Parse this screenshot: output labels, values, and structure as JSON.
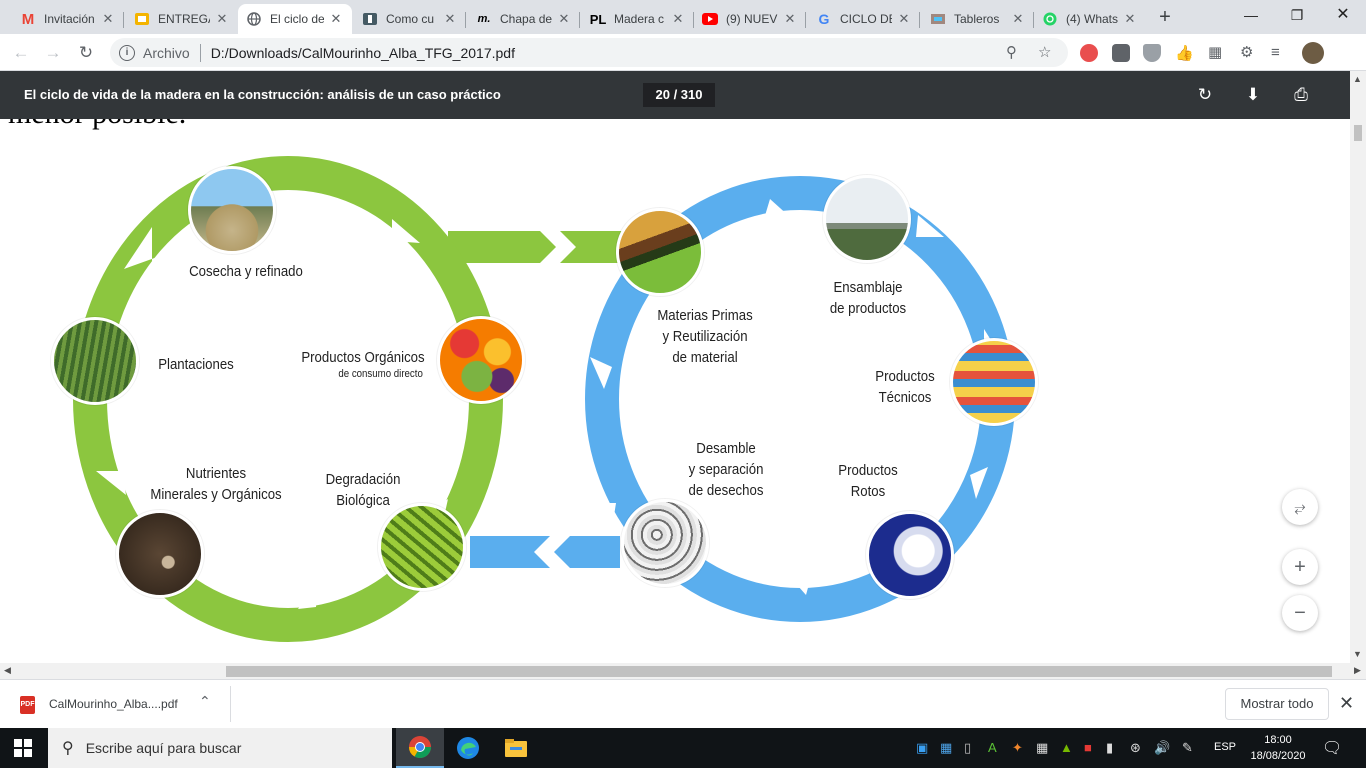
{
  "browser": {
    "tabs": [
      {
        "title": "Invitación",
        "icon": "gmail-icon",
        "color": "#ea4335"
      },
      {
        "title": "ENTREGA",
        "icon": "slides-icon",
        "color": "#f4b400"
      },
      {
        "title": "El ciclo de",
        "icon": "globe-icon",
        "color": "#5f6368"
      },
      {
        "title": "Como cu",
        "icon": "book-icon",
        "color": "#455a64"
      },
      {
        "title": "Chapa de",
        "icon": "m-icon",
        "color": "#000000"
      },
      {
        "title": "Madera c",
        "icon": "pl-icon",
        "color": "#000000"
      },
      {
        "title": "(9) NUEV",
        "icon": "youtube-icon",
        "color": "#ff0000"
      },
      {
        "title": "CICLO DE",
        "icon": "google-icon",
        "color": "#4285f4"
      },
      {
        "title": "Tableros",
        "icon": "wood-icon",
        "color": "#8d6e63"
      },
      {
        "title": "(4) Whats",
        "icon": "whatsapp-icon",
        "color": "#25d366"
      }
    ],
    "address": {
      "scheme": "Archivo",
      "url": "D:/Downloads/CalMourinho_Alba_TFG_2017.pdf"
    }
  },
  "pdf": {
    "title": "El ciclo de vida de la madera en la construcción: análisis de un caso práctico",
    "page_indicator": "20 / 310",
    "cut_text": "menor posible."
  },
  "diagram": {
    "green_cycle": [
      {
        "label": "Cosecha y refinado"
      },
      {
        "label": "Plantaciones"
      },
      {
        "label": "Productos Orgánicos",
        "sub": "de consumo directo"
      },
      {
        "label": "Nutrientes",
        "label2": "Minerales y Orgánicos"
      },
      {
        "label": "Degradación",
        "label2": "Biológica"
      }
    ],
    "blue_cycle": [
      {
        "label": "Materias Primas",
        "label2": "y Reutilización",
        "label3": "de material"
      },
      {
        "label": "Ensamblaje",
        "label2": "de productos"
      },
      {
        "label": "Productos",
        "label2": "Técnicos"
      },
      {
        "label": "Desamble",
        "label2": "y separación",
        "label3": "de desechos"
      },
      {
        "label": "Productos",
        "label2": "Rotos"
      }
    ],
    "colors": {
      "green": "#8cc63f",
      "blue": "#5aaeee"
    }
  },
  "downloads": {
    "file": "CalMourinho_Alba....pdf",
    "show_all": "Mostrar todo"
  },
  "taskbar": {
    "search_placeholder": "Escribe aquí para buscar",
    "language": "ESP",
    "time": "18:00",
    "date": "18/08/2020"
  }
}
